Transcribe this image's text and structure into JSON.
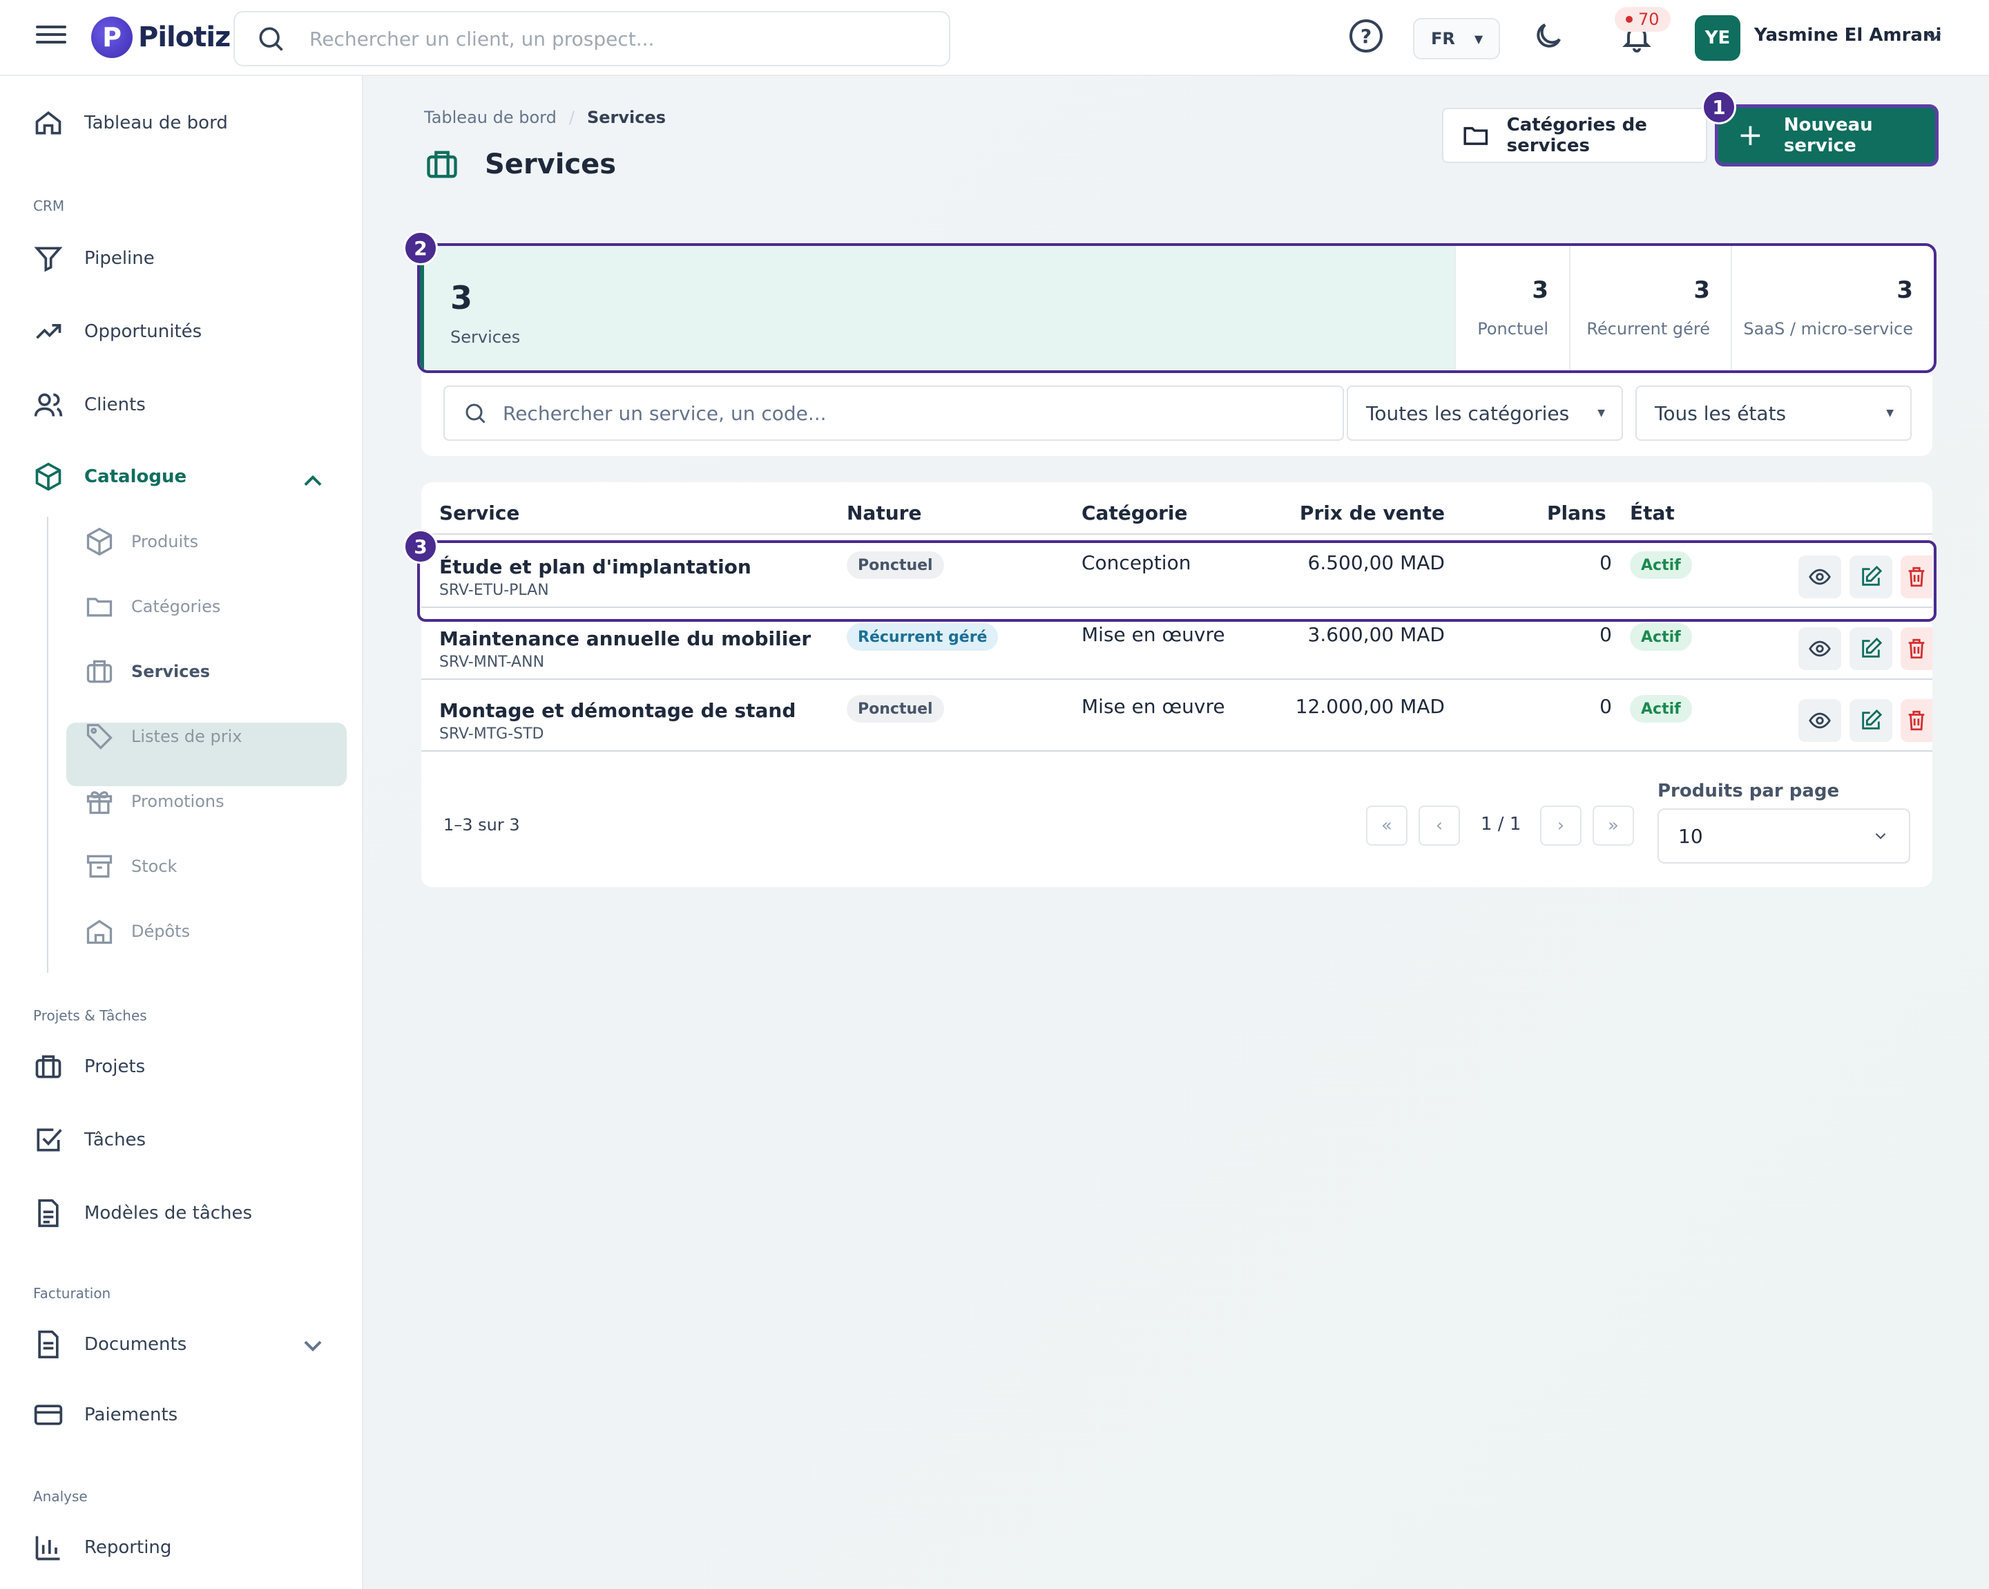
{
  "header": {
    "app_name": "Pilotiz",
    "logo_letter": "P",
    "search_placeholder": "Rechercher un client, un prospect...",
    "help_label": "?",
    "lang": "FR",
    "notifications_count": "70",
    "user_initials": "YE",
    "user_name": "Yasmine El Amrani"
  },
  "sidebar": {
    "dashboard": "Tableau de bord",
    "sections": {
      "crm": "CRM",
      "projects": "Projets & Tâches",
      "billing": "Facturation",
      "analysis": "Analyse"
    },
    "crm_items": [
      "Pipeline",
      "Opportunités",
      "Clients"
    ],
    "catalogue": "Catalogue",
    "catalogue_items": [
      "Produits",
      "Catégories",
      "Services",
      "Listes de prix",
      "Promotions",
      "Stock",
      "Dépôts"
    ],
    "project_items": [
      "Projets",
      "Tâches",
      "Modèles de tâches"
    ],
    "billing_items": [
      "Documents",
      "Paiements"
    ],
    "analysis_items": [
      "Reporting"
    ],
    "active_item": "Services"
  },
  "page": {
    "breadcrumb": [
      "Tableau de bord",
      "/",
      "Services"
    ],
    "title": "Services",
    "btn_categories": "Catégories de services",
    "btn_new": "Nouveau service"
  },
  "markers": [
    "1",
    "2",
    "3"
  ],
  "stats": {
    "total": "3",
    "total_label": "Services",
    "items": [
      {
        "value": "3",
        "label": "Ponctuel"
      },
      {
        "value": "3",
        "label": "Récurrent géré"
      },
      {
        "value": "3",
        "label": "SaaS / micro-service"
      }
    ]
  },
  "filters": {
    "search_placeholder": "Rechercher un service, un code...",
    "category": "Toutes les catégories",
    "state": "Tous les états"
  },
  "table": {
    "columns": [
      "Service",
      "Nature",
      "Catégorie",
      "Prix de vente",
      "Plans",
      "État"
    ],
    "rows": [
      {
        "name": "Étude et plan d'implantation",
        "code": "SRV-ETU-PLAN",
        "nature": "Ponctuel",
        "category": "Conception",
        "price": "6.500,00 MAD",
        "plans": "0",
        "state": "Actif"
      },
      {
        "name": "Maintenance annuelle du mobilier",
        "code": "SRV-MNT-ANN",
        "nature": "Récurrent géré",
        "category": "Mise en œuvre",
        "price": "3.600,00 MAD",
        "plans": "0",
        "state": "Actif"
      },
      {
        "name": "Montage et démontage de stand",
        "code": "SRV-MTG-STD",
        "nature": "Ponctuel",
        "category": "Mise en œuvre",
        "price": "12.000,00 MAD",
        "plans": "0",
        "state": "Actif"
      }
    ]
  },
  "pagination": {
    "info": "1–3 sur 3",
    "first": "«",
    "prev": "‹",
    "page": "1 / 1",
    "next": "›",
    "last": "»",
    "per_page_label": "Produits par page",
    "per_page": "10"
  },
  "colors": {
    "brand": "#0f6e5e",
    "highlight": "#4a2b8f",
    "active_bg": "#dce9e8"
  }
}
